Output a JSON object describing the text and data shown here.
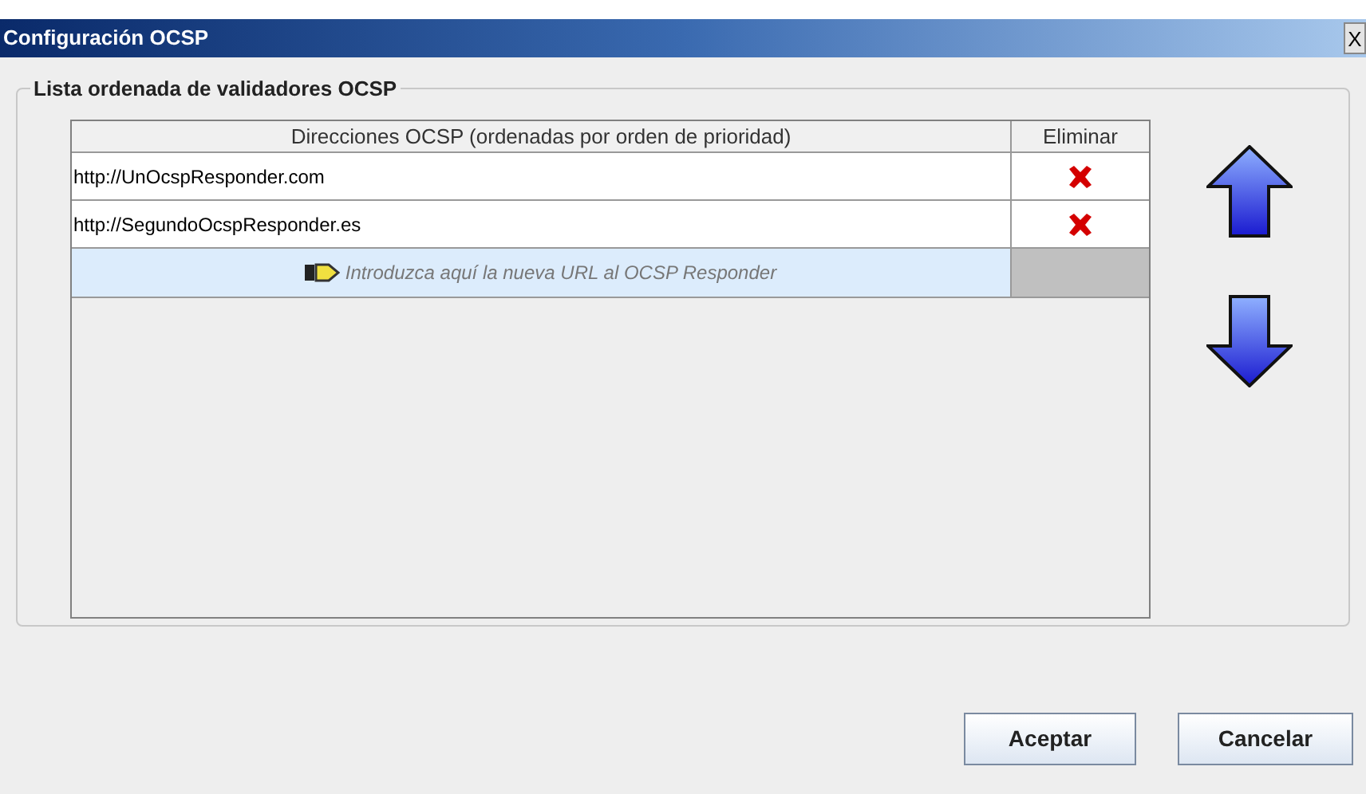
{
  "window": {
    "title": "Configuración OCSP",
    "close": "X"
  },
  "group": {
    "title": "Lista ordenada de validadores OCSP"
  },
  "table": {
    "columns": [
      "Direcciones OCSP (ordenadas por orden de prioridad)",
      "Eliminar"
    ],
    "rows": [
      {
        "url": "http://UnOcspResponder.com"
      },
      {
        "url": "http://SegundoOcspResponder.es"
      }
    ],
    "new_row": {
      "placeholder": "Introduzca aquí la nueva URL al OCSP Responder"
    }
  },
  "buttons": [
    "Aceptar",
    "Cancelar"
  ]
}
